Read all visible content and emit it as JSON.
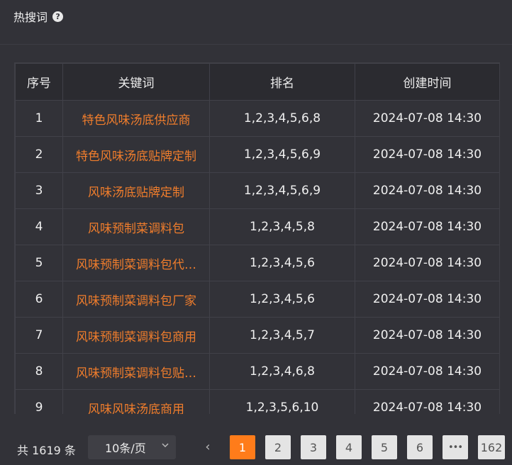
{
  "header": {
    "title": "热搜词",
    "help_glyph": "?"
  },
  "table": {
    "columns": [
      "序号",
      "关键词",
      "排名",
      "创建时间"
    ],
    "rows": [
      {
        "no": "1",
        "keyword": "特色风味汤底供应商",
        "rank": "1,2,3,4,5,6,8",
        "time": "2024-07-08 14:30"
      },
      {
        "no": "2",
        "keyword": "特色风味汤底贴牌定制",
        "rank": "1,2,3,4,5,6,9",
        "time": "2024-07-08 14:30"
      },
      {
        "no": "3",
        "keyword": "风味汤底贴牌定制",
        "rank": "1,2,3,4,5,6,9",
        "time": "2024-07-08 14:30"
      },
      {
        "no": "4",
        "keyword": "风味预制菜调料包",
        "rank": "1,2,3,4,5,8",
        "time": "2024-07-08 14:30"
      },
      {
        "no": "5",
        "keyword": "风味预制菜调料包代…",
        "rank": "1,2,3,4,5,6",
        "time": "2024-07-08 14:30"
      },
      {
        "no": "6",
        "keyword": "风味预制菜调料包厂家",
        "rank": "1,2,3,4,5,6",
        "time": "2024-07-08 14:30"
      },
      {
        "no": "7",
        "keyword": "风味预制菜调料包商用",
        "rank": "1,2,3,4,5,7",
        "time": "2024-07-08 14:30"
      },
      {
        "no": "8",
        "keyword": "风味预制菜调料包贴…",
        "rank": "1,2,3,4,6,8",
        "time": "2024-07-08 14:30"
      },
      {
        "no": "9",
        "keyword": "风味风味汤底商用",
        "rank": "1,2,3,5,6,10",
        "time": "2024-07-08 14:30"
      }
    ]
  },
  "pagination": {
    "total_label": "共 1619 条",
    "page_size": "10条/页",
    "prev_glyph": "‹",
    "pages": [
      "1",
      "2",
      "3",
      "4",
      "5",
      "6",
      "•••",
      "162"
    ],
    "active_page": "1"
  },
  "colors": {
    "accent": "#ff7c1a",
    "keyword": "#f07d2c",
    "background": "#323238",
    "header_bg": "#2b2b30"
  }
}
